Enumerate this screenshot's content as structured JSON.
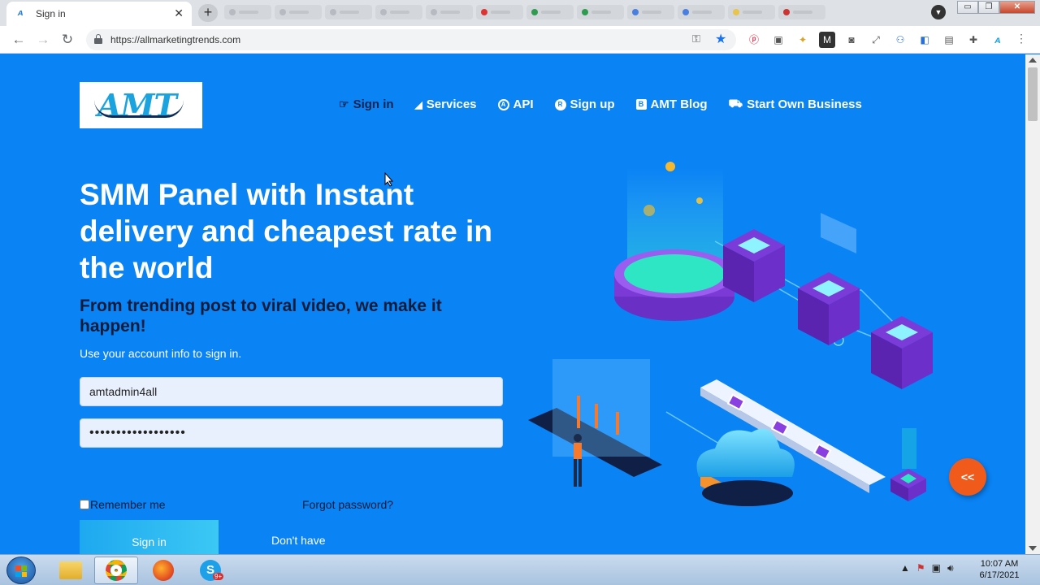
{
  "browser": {
    "tab_title": "Sign in",
    "tab_close": "✕",
    "new_tab": "+",
    "url": "https://allmarketingtrends.com",
    "window_controls": [
      "▭",
      "❐",
      "✕"
    ]
  },
  "site": {
    "logo_text": "AMT",
    "nav": [
      {
        "label": "Sign in",
        "icon": "pointing-hand-icon"
      },
      {
        "label": "Services",
        "icon": "services-icon"
      },
      {
        "label": "API",
        "icon": "api-icon"
      },
      {
        "label": "Sign up",
        "icon": "registered-icon"
      },
      {
        "label": "AMT Blog",
        "icon": "blogger-icon"
      },
      {
        "label": "Start Own Business",
        "icon": "truck-icon"
      }
    ],
    "hero_title": "SMM Panel with Instant delivery and cheapest rate in the world",
    "hero_subtitle": "From trending post to viral video, we make it happen!",
    "hint": "Use your account info to sign in.",
    "username_value": "amtadmin4all",
    "password_value": "••••••••••••••••••",
    "remember_label": "Remember me",
    "forgot_label": "Forgot password?",
    "signin_button": "Sign in",
    "dont_have": "Don't have",
    "fab_label": "<<"
  },
  "taskbar": {
    "time": "10:07 AM",
    "date": "6/17/2021",
    "skype_badge": "9+"
  },
  "colors": {
    "page_bg": "#0a83f5",
    "active_nav": "#0b2552",
    "fab": "#f05a1a"
  }
}
